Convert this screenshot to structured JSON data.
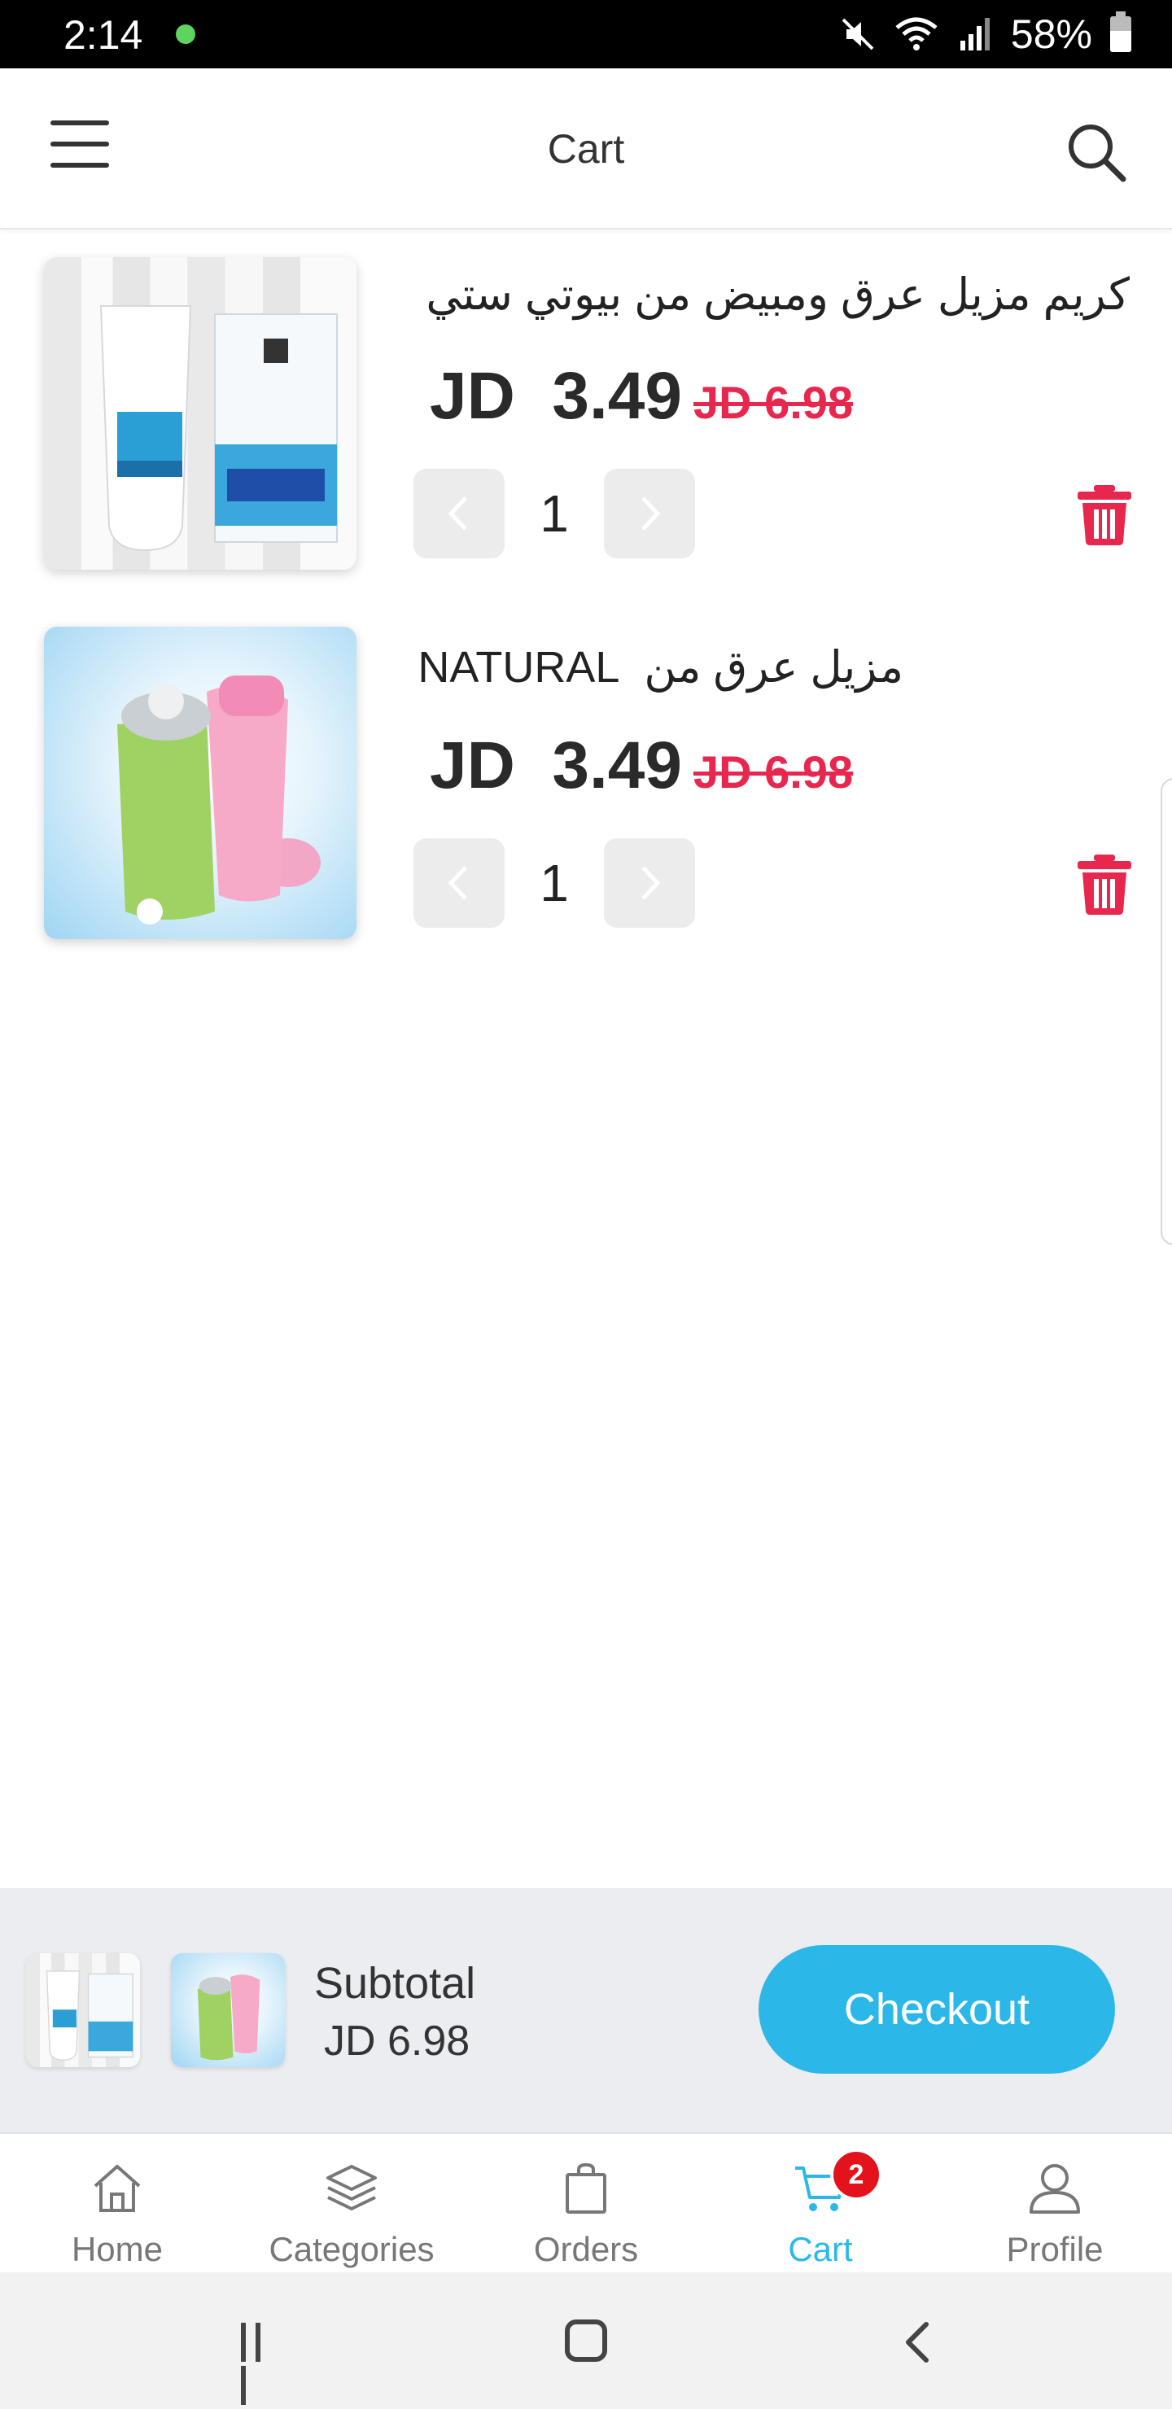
{
  "status_bar": {
    "time": "2:14",
    "battery": "58%",
    "icons": [
      "mute-icon",
      "wifi-icon",
      "signal-icon",
      "battery-icon"
    ]
  },
  "header": {
    "title": "Cart",
    "menu_icon": "hamburger-menu-icon",
    "search_icon": "search-icon"
  },
  "cart": {
    "items": [
      {
        "name": "كريم مزيل عرق ومبيض من بيوتي ستي",
        "price": "JD  3.49",
        "old_price": "JD 6.98",
        "quantity": "1",
        "image": "beauty-city-fragrance-remover-cream"
      },
      {
        "name": "مزيل عرق من  NATURAL",
        "price": "JD  3.49",
        "old_price": "JD 6.98",
        "quantity": "1",
        "image": "natural-roll-on-deodorant"
      }
    ]
  },
  "summary": {
    "subtotal_label": "Subtotal",
    "subtotal_value": "JD 6.98",
    "checkout_label": "Checkout"
  },
  "bottom_nav": {
    "items": [
      {
        "label": "Home",
        "icon": "home-icon"
      },
      {
        "label": "Categories",
        "icon": "layers-icon"
      },
      {
        "label": "Orders",
        "icon": "shopping-bag-icon"
      },
      {
        "label": "Cart",
        "icon": "cart-icon",
        "badge": "2",
        "active": true
      },
      {
        "label": "Profile",
        "icon": "user-icon"
      }
    ]
  },
  "colors": {
    "accent": "#2bb8e8",
    "sale_price": "#e8274e",
    "badge": "#e4131b"
  }
}
